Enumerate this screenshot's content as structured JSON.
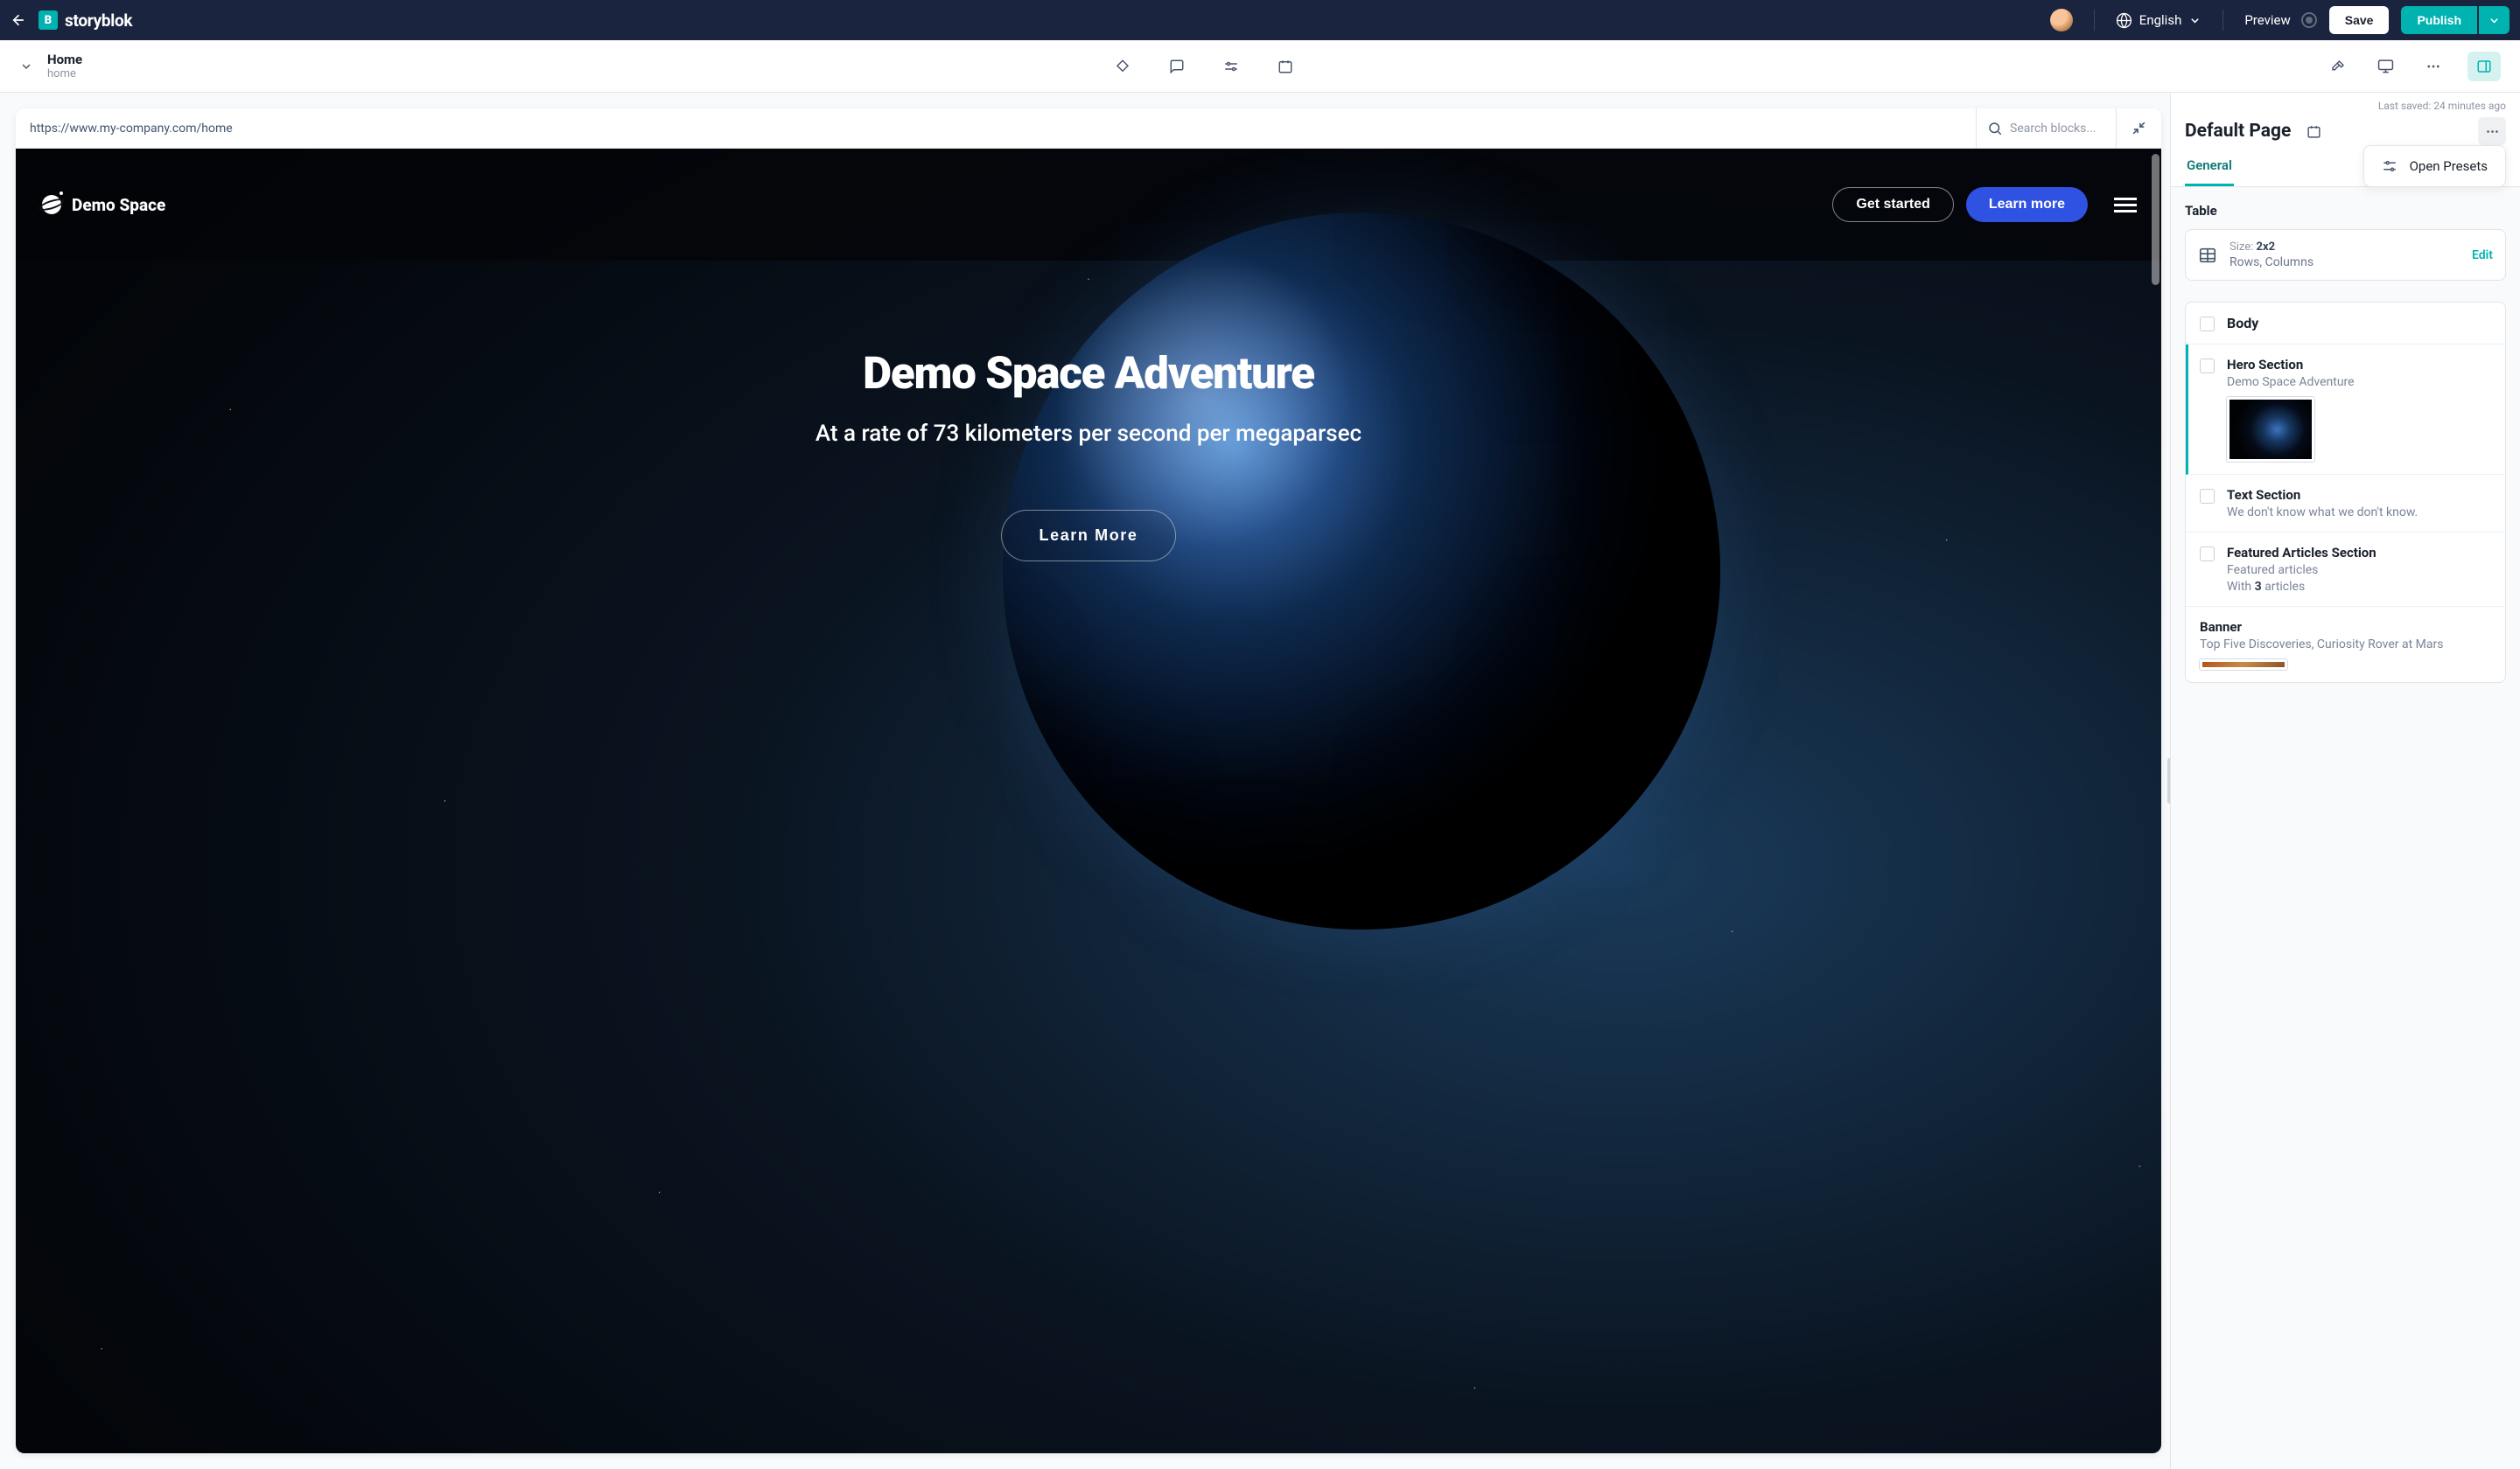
{
  "topbar": {
    "logo": "storyblok",
    "language": "English",
    "preview": "Preview",
    "save": "Save",
    "publish": "Publish"
  },
  "subbar": {
    "title": "Home",
    "slug": "home"
  },
  "frame": {
    "url": "https://www.my-company.com/home",
    "search_placeholder": "Search blocks..."
  },
  "site": {
    "brand": "Demo Space",
    "cta_get_started": "Get started",
    "cta_learn_more": "Learn more",
    "hero_title": "Demo Space Adventure",
    "hero_subtitle": "At a rate of 73 kilometers per second per megaparsec",
    "hero_button": "Learn More"
  },
  "sidebar": {
    "last_saved": "Last saved: 24 minutes ago",
    "title": "Default Page",
    "tab_general": "General",
    "open_presets": "Open Presets",
    "table_label": "Table",
    "table_size_label": "Size: ",
    "table_size_value": "2x2",
    "table_rc": "Rows, Columns",
    "edit": "Edit",
    "blocks": {
      "body": "Body",
      "hero_title": "Hero Section",
      "hero_sub": "Demo Space Adventure",
      "text_title": "Text Section",
      "text_sub": "We don't know what we don't know.",
      "featured_title": "Featured Articles Section",
      "featured_sub1": "Featured articles",
      "featured_sub2a": "With ",
      "featured_sub2b": "3",
      "featured_sub2c": " articles",
      "banner_title": "Banner",
      "banner_sub": "Top Five Discoveries, Curiosity Rover at Mars"
    }
  }
}
